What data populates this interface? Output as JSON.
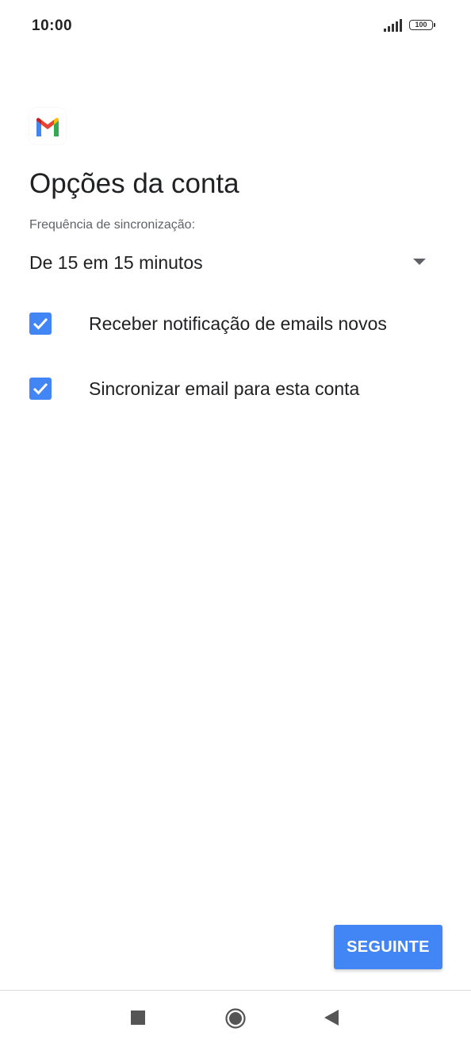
{
  "status_bar": {
    "time": "10:00",
    "battery": "100",
    "signal_icon": "signal-icon",
    "battery_icon": "battery-icon"
  },
  "header": {
    "logo_icon": "gmail-logo-icon",
    "title": "Opções da conta"
  },
  "sync": {
    "label": "Frequência de sincronização:",
    "selected": "De 15 em 15 minutos",
    "icon": "dropdown-arrow-icon"
  },
  "options": [
    {
      "label": "Receber notificação de emails novos",
      "checked": true
    },
    {
      "label": "Sincronizar email para esta conta",
      "checked": true
    }
  ],
  "actions": {
    "next_label": "SEGUINTE"
  },
  "nav": {
    "recent_icon": "recent-apps-icon",
    "home_icon": "home-icon",
    "back_icon": "back-icon"
  },
  "colors": {
    "accent": "#4285f4",
    "text_primary": "#202124",
    "text_secondary": "#5f6368"
  }
}
